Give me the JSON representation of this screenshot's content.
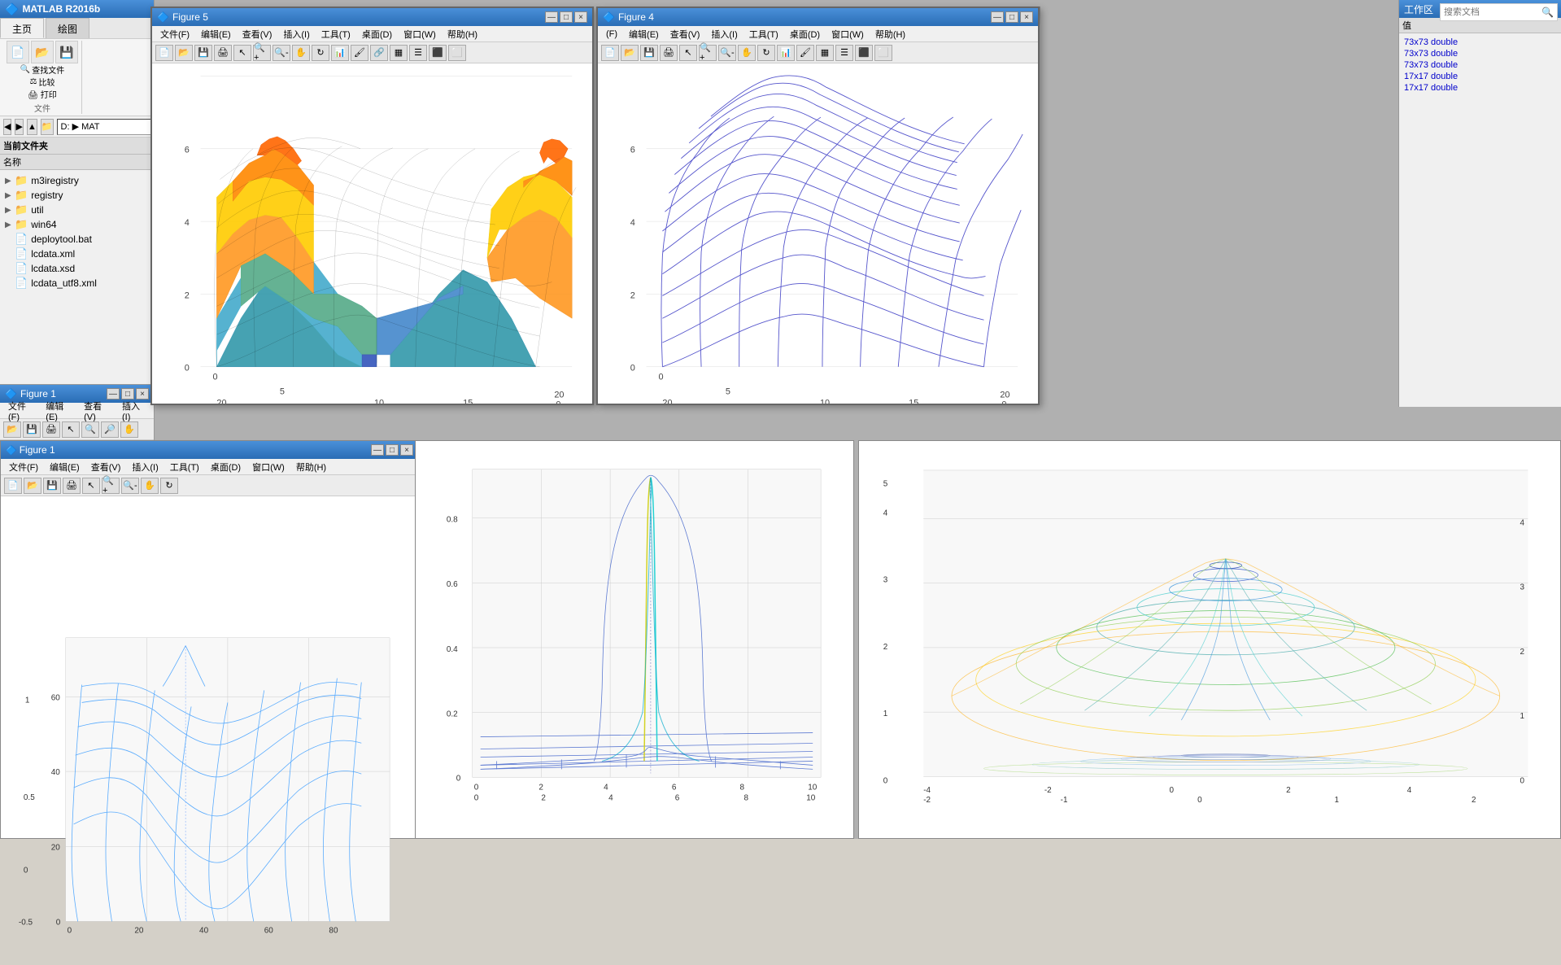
{
  "matlab": {
    "title": "MATLAB R2016b",
    "tabs": [
      "主页",
      "绘图"
    ],
    "active_tab": "主页",
    "address": "D: ▶ MAT",
    "file_tree": {
      "header": "当前文件夹",
      "name_col": "名称",
      "items": [
        {
          "type": "folder",
          "name": "m3iregistry",
          "expanded": false
        },
        {
          "type": "folder",
          "name": "registry",
          "expanded": false
        },
        {
          "type": "folder",
          "name": "util",
          "expanded": false
        },
        {
          "type": "folder",
          "name": "win64",
          "expanded": false
        },
        {
          "type": "file",
          "name": "deploytool.bat"
        },
        {
          "type": "file",
          "name": "lcdata.xml"
        },
        {
          "type": "file",
          "name": "lcdata.xsd"
        },
        {
          "type": "file",
          "name": "lcdata_utf8.xml"
        }
      ]
    }
  },
  "workspace": {
    "header": "值",
    "rows": [
      {
        "name": "",
        "type": "73x73 double"
      },
      {
        "name": "",
        "type": "73x73 double"
      },
      {
        "name": "",
        "type": "73x73 double"
      },
      {
        "name": "",
        "type": "17x17 double"
      },
      {
        "name": "",
        "type": "17x17 double"
      }
    ]
  },
  "figure5": {
    "title": "Figure 5",
    "menus": [
      "文件(F)",
      "编辑(E)",
      "查看(V)",
      "插入(I)",
      "工具(T)",
      "桌面(D)",
      "窗口(W)",
      "帮助(H)"
    ],
    "plot": {
      "type": "surf_colored",
      "x_range": [
        0,
        20
      ],
      "y_range": [
        0,
        20
      ],
      "z_range": [
        0,
        6
      ],
      "description": "Colored surface plot - peaks-like shape, yellow/green/teal colors"
    }
  },
  "figure4": {
    "title": "Figure 4",
    "menus": [
      "(F)",
      "编辑(E)",
      "查看(V)",
      "插入(I)",
      "工具(T)",
      "桌面(D)",
      "窗口(W)",
      "帮助(H)"
    ],
    "plot": {
      "type": "mesh_blue",
      "x_range": [
        0,
        20
      ],
      "y_range": [
        0,
        20
      ],
      "z_range": [
        0,
        6
      ],
      "description": "Blue wireframe mesh surface plot"
    }
  },
  "figure1_small": {
    "title": "Figure 1",
    "menus": [
      "文件(F)",
      "编辑(E)",
      "查看(V)",
      "插入(I)"
    ]
  },
  "bottom_figs": {
    "fig_left": {
      "description": "Blue mesh peaks function - complex wavy surface",
      "axes": {
        "x": [
          0,
          20,
          40,
          60,
          80
        ],
        "y": [
          0,
          20,
          40,
          60
        ],
        "z": [
          -0.5,
          0,
          0.5,
          1
        ]
      }
    },
    "fig_center": {
      "description": "Blue/cyan mesh with spike - sinc-like function",
      "axes": {
        "x": [
          0,
          2,
          4,
          6,
          8,
          10
        ],
        "y": [
          0,
          2,
          4,
          6,
          8,
          10
        ],
        "z": [
          0,
          0.2,
          0.4,
          0.6,
          0.8
        ]
      }
    },
    "fig_right": {
      "description": "Colorful mesh funnel/bowl with contours",
      "axes": {
        "x": [
          -4,
          -2,
          0,
          2,
          4
        ],
        "y": [
          -2,
          -1,
          0,
          1,
          2
        ],
        "z": [
          0,
          1,
          2,
          3,
          4,
          5
        ]
      }
    }
  },
  "search": {
    "placeholder": "搜索文档"
  },
  "icons": {
    "new": "📄",
    "open": "📂",
    "save": "💾",
    "print": "🖨",
    "folder": "📁",
    "file_bat": "📄",
    "file_xml": "📄",
    "file_xsd": "📄",
    "expand": "▶",
    "collapse": "▼",
    "back": "◀",
    "forward": "▶",
    "up": "▲"
  }
}
